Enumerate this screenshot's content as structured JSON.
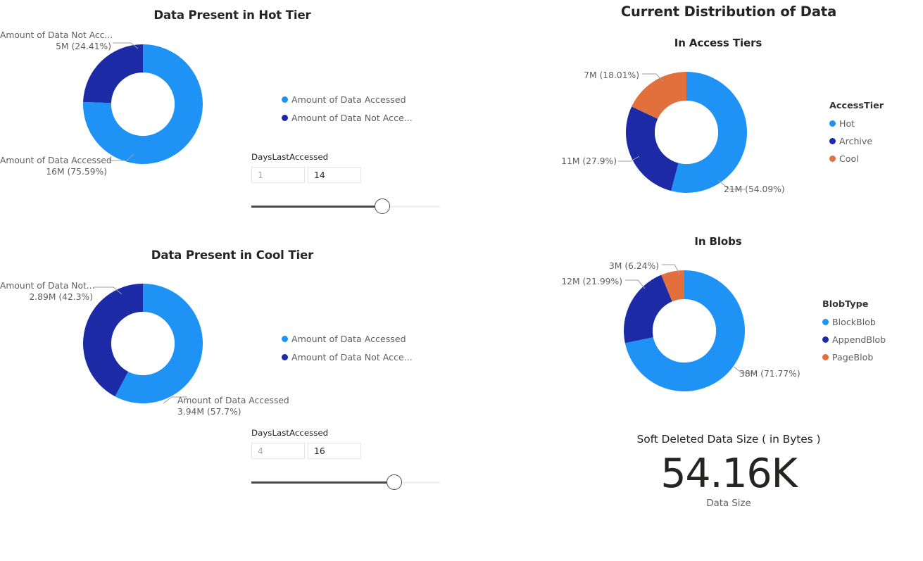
{
  "report": {
    "background": "#ffffff",
    "palette": {
      "blue": "#1f92f5",
      "dark_blue": "#1c2ba5",
      "orange": "#e1703c",
      "label_gray": "#605e5c",
      "leader_gray": "#a19f9d",
      "title_dark": "#252423"
    }
  },
  "hot_tier": {
    "title": "Data Present in Hot Tier",
    "labels": {
      "not_accessed_name": "Amount of Data Not Acc...",
      "not_accessed_value": "5M (24.41%)",
      "accessed_name": "Amount of Data Accessed",
      "accessed_value": "16M (75.59%)"
    },
    "legend": {
      "items": [
        {
          "label": "Amount of Data Accessed",
          "color": "#1f92f5"
        },
        {
          "label": "Amount of Data Not Acce...",
          "color": "#1c2ba5"
        }
      ]
    },
    "slicer": {
      "label": "DaysLastAccessed",
      "min_value": "1",
      "max_value": "14",
      "handle_percent": 69
    }
  },
  "cool_tier": {
    "title": "Data Present in Cool Tier",
    "labels": {
      "not_accessed_name": "Amount of Data Not...",
      "not_accessed_value": "2.89M (42.3%)",
      "accessed_name": "Amount of Data Accessed",
      "accessed_value": "3.94M (57.7%)"
    },
    "legend": {
      "items": [
        {
          "label": "Amount of Data Accessed",
          "color": "#1f92f5"
        },
        {
          "label": "Amount of Data Not Acce...",
          "color": "#1c2ba5"
        }
      ]
    },
    "slicer": {
      "label": "DaysLastAccessed",
      "min_value": "4",
      "max_value": "16",
      "handle_percent": 75
    }
  },
  "right_panel": {
    "title": "Current Distribution of Data",
    "access_tiers": {
      "title": "In Access Tiers",
      "legend_title": "AccessTier",
      "labels": {
        "cool": "7M (18.01%)",
        "archive": "11M (27.9%)",
        "hot": "21M (54.09%)"
      },
      "legend": {
        "items": [
          {
            "label": "Hot",
            "color": "#1f92f5"
          },
          {
            "label": "Archive",
            "color": "#1c2ba5"
          },
          {
            "label": "Cool",
            "color": "#e1703c"
          }
        ]
      }
    },
    "blobs": {
      "title": "In Blobs",
      "legend_title": "BlobType",
      "labels": {
        "page": "3M (6.24%)",
        "append": "12M (21.99%)",
        "block": "38M (71.77%)"
      },
      "legend": {
        "items": [
          {
            "label": "BlockBlob",
            "color": "#1f92f5"
          },
          {
            "label": "AppendBlob",
            "color": "#1c2ba5"
          },
          {
            "label": "PageBlob",
            "color": "#e1703c"
          }
        ]
      }
    },
    "soft_deleted": {
      "title": "Soft Deleted Data Size ( in Bytes )",
      "value": "54.16K",
      "subtitle": "Data Size"
    }
  },
  "chart_data": [
    {
      "type": "pie",
      "id": "hot-tier-donut",
      "title": "Data Present in Hot Tier",
      "donut": true,
      "legend_position": "right",
      "categories": [
        "Amount of Data Accessed",
        "Amount of Data Not Accessed"
      ],
      "values": [
        16000000,
        5000000
      ],
      "value_labels": [
        "16M (75.59%)",
        "5M (24.41%)"
      ],
      "percents": [
        75.59,
        24.41
      ],
      "colors": [
        "#1f92f5",
        "#1c2ba5"
      ]
    },
    {
      "type": "pie",
      "id": "cool-tier-donut",
      "title": "Data Present in Cool Tier",
      "donut": true,
      "legend_position": "right",
      "categories": [
        "Amount of Data Accessed",
        "Amount of Data Not Accessed"
      ],
      "values": [
        3940000,
        2890000
      ],
      "value_labels": [
        "3.94M (57.7%)",
        "2.89M (42.3%)"
      ],
      "percents": [
        57.7,
        42.3
      ],
      "colors": [
        "#1f92f5",
        "#1c2ba5"
      ]
    },
    {
      "type": "pie",
      "id": "access-tiers-donut",
      "title": "In Access Tiers",
      "donut": true,
      "legend_title": "AccessTier",
      "legend_position": "right",
      "categories": [
        "Hot",
        "Archive",
        "Cool"
      ],
      "values": [
        21000000,
        11000000,
        7000000
      ],
      "value_labels": [
        "21M (54.09%)",
        "11M (27.9%)",
        "7M (18.01%)"
      ],
      "percents": [
        54.09,
        27.9,
        18.01
      ],
      "colors": [
        "#1f92f5",
        "#1c2ba5",
        "#e1703c"
      ]
    },
    {
      "type": "pie",
      "id": "blobs-donut",
      "title": "In Blobs",
      "donut": true,
      "legend_title": "BlobType",
      "legend_position": "right",
      "categories": [
        "BlockBlob",
        "AppendBlob",
        "PageBlob"
      ],
      "values": [
        38000000,
        12000000,
        3000000
      ],
      "value_labels": [
        "38M (71.77%)",
        "12M (21.99%)",
        "3M (6.24%)"
      ],
      "percents": [
        71.77,
        21.99,
        6.24
      ],
      "colors": [
        "#1f92f5",
        "#1c2ba5",
        "#e1703c"
      ]
    },
    {
      "type": "table",
      "id": "soft-deleted-card",
      "title": "Soft Deleted Data Size ( in Bytes )",
      "categories": [
        "Data Size"
      ],
      "value_labels": [
        "54.16K"
      ]
    }
  ]
}
